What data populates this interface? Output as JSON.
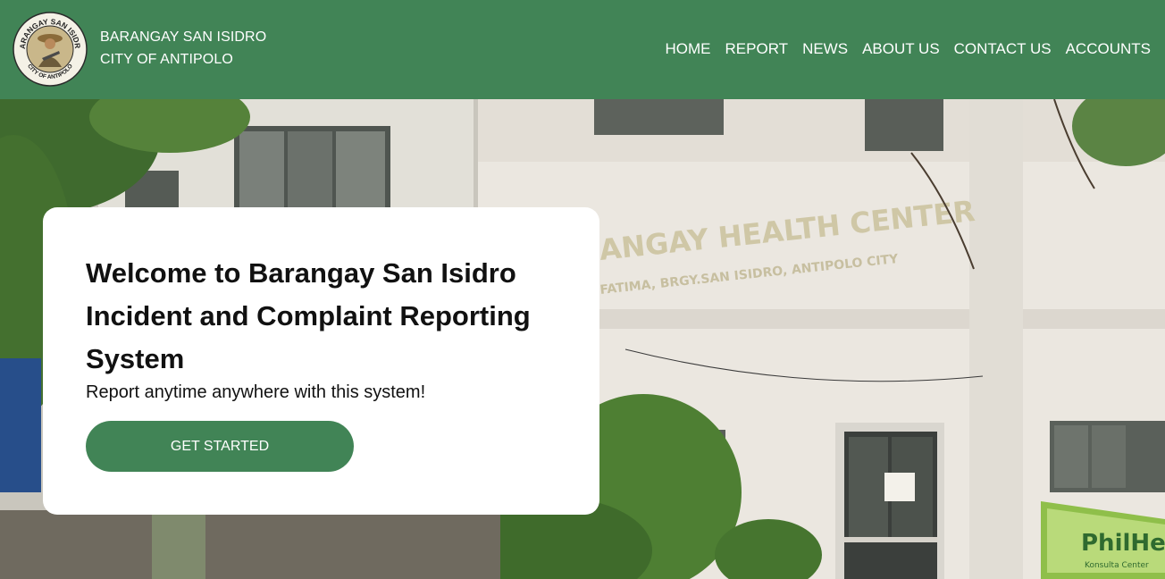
{
  "brand": {
    "logo_text_top": "BARANGAY SAN ISIDRO",
    "logo_text_bottom": "CITY OF ANTIPOLO",
    "line1": "BARANGAY SAN ISIDRO",
    "line2": "CITY OF ANTIPOLO"
  },
  "nav": {
    "items": [
      "HOME",
      "REPORT",
      "NEWS",
      "ABOUT US",
      "CONTACT US",
      "ACCOUNTS"
    ]
  },
  "hero": {
    "sign_main": "ANGAY HEALTH CENTER",
    "sign_sub": "FATIMA, BRGY.SAN ISIDRO, ANTIPOLO CITY",
    "banner_text": "PhilHe",
    "banner_sub": "Konsulta Center"
  },
  "welcome": {
    "title": "Welcome to Barangay San Isidro Incident and Complaint Reporting System",
    "subtitle": "Report anytime anywhere with this system!",
    "button_label": "GET STARTED"
  },
  "colors": {
    "primary": "#418456",
    "text": "#111111",
    "card": "#ffffff"
  }
}
